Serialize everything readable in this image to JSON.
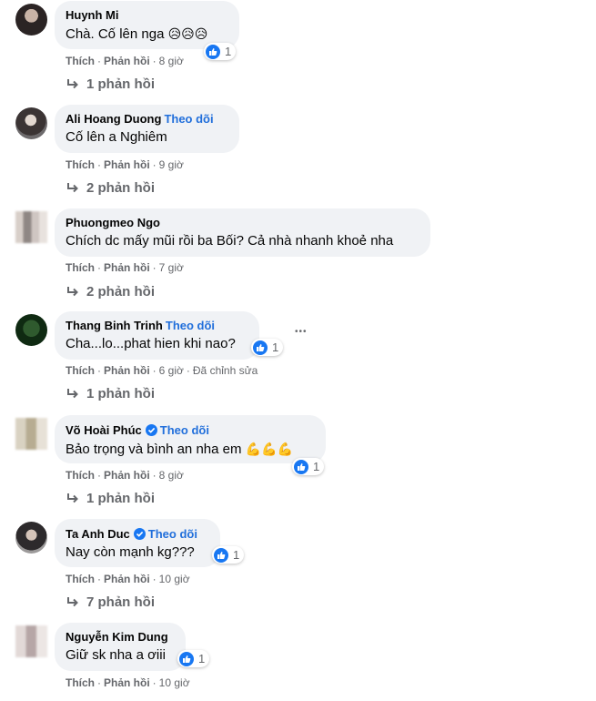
{
  "colors": {
    "link_blue": "#216fdb",
    "like_blue": "#1877f2",
    "bubble_bg": "#f0f2f5",
    "meta_gray": "#65676b"
  },
  "labels": {
    "like": "Thích",
    "reply": "Phản hồi",
    "follow": "Theo dõi",
    "edited": "Đã chỉnh sửa"
  },
  "comments": [
    {
      "name": "Huynh Mi",
      "text": "Chà. Cố lên nga",
      "emoji": "😥😥😥",
      "likes": "1",
      "time": "8 giờ",
      "replies": "1 phản hồi"
    },
    {
      "name": "Ali Hoang Duong",
      "text": "Cố lên a Nghiêm",
      "time": "9 giờ",
      "replies": "2 phản hồi"
    },
    {
      "name": "Phuongmeo Ngo",
      "text": "Chích dc mấy mũi rồi ba Bối? Cả nhà nhanh khoẻ nha",
      "time": "7 giờ",
      "replies": "2 phản hồi"
    },
    {
      "name": "Thang Binh Trinh",
      "text": "Cha...lo...phat hien khi nao?",
      "likes": "1",
      "time": "6 giờ",
      "replies": "1 phản hồi",
      "more": "•••"
    },
    {
      "name": "Võ Hoài Phúc",
      "text": "Bảo trọng và bình an nha em",
      "emoji": "💪💪💪",
      "likes": "1",
      "time": "8 giờ",
      "replies": "1 phản hồi"
    },
    {
      "name": "Ta Anh Duc",
      "text": "Nay còn mạnh kg???",
      "likes": "1",
      "time": "10 giờ",
      "replies": "7 phản hồi"
    },
    {
      "name": "Nguyễn Kim Dung",
      "text": "Giữ sk nha a ơiii",
      "likes": "1",
      "time": "10 giờ"
    }
  ]
}
